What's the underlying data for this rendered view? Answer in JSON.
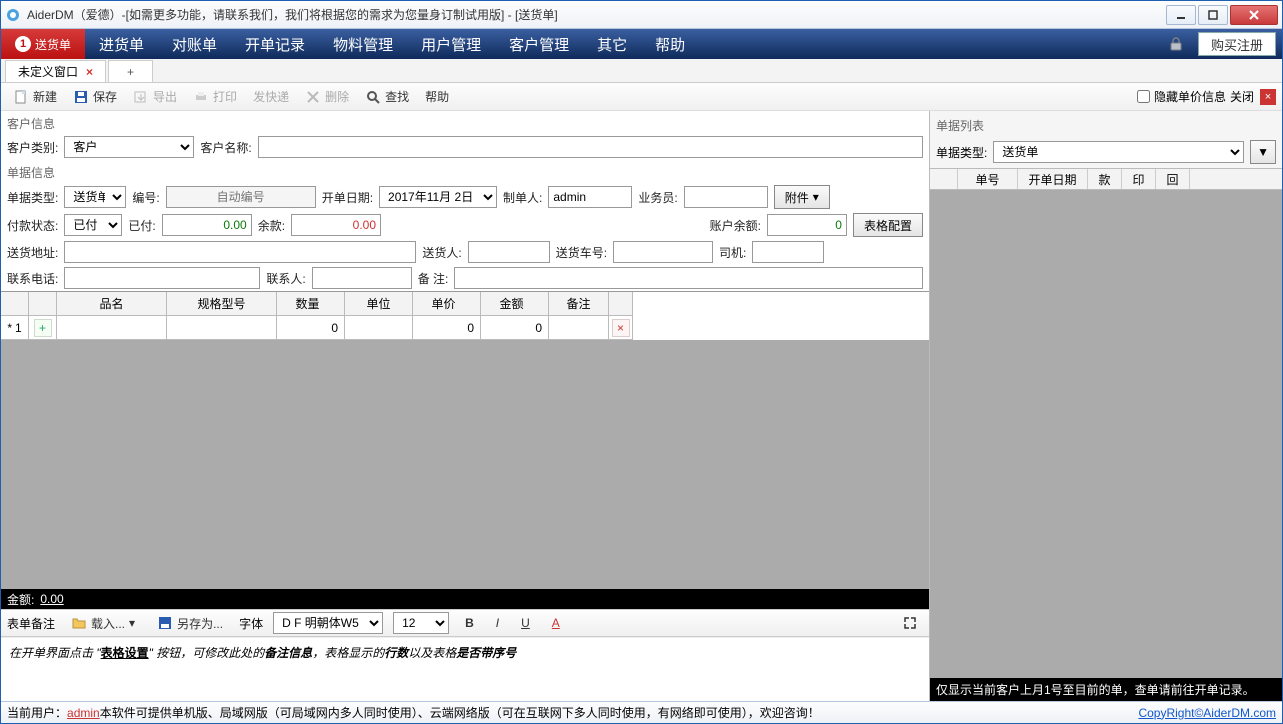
{
  "window": {
    "title": "AiderDM（爱德）-[如需更多功能，请联系我们，我们将根据您的需求为您量身订制试用版] - [送货单]"
  },
  "menubar": {
    "items": [
      "送货单",
      "进货单",
      "对账单",
      "开单记录",
      "物料管理",
      "用户管理",
      "客户管理",
      "其它",
      "帮助"
    ],
    "active_badge": "1",
    "buy": "购买注册"
  },
  "tabs": {
    "t0": "未定义窗口"
  },
  "toolbar": {
    "new": "新建",
    "save": "保存",
    "export": "导出",
    "print": "打印",
    "express": "发快递",
    "delete": "删除",
    "find": "查找",
    "help": "帮助",
    "hideprice": "隐藏单价信息",
    "close": "关闭"
  },
  "cust": {
    "section": "客户信息",
    "type_label": "客户类别:",
    "type_value": "客户",
    "name_label": "客户名称:",
    "name_value": ""
  },
  "doc": {
    "section": "单据信息",
    "type_label": "单据类型:",
    "type_value": "送货单",
    "no_label": "编号:",
    "no_placeholder": "自动编号",
    "date_label": "开单日期:",
    "date_value": "2017年11月  2日",
    "maker_label": "制单人:",
    "maker_value": "admin",
    "sales_label": "业务员:",
    "sales_value": "",
    "attach": "附件",
    "paystat_label": "付款状态:",
    "paystat_value": "已付",
    "paid_label": "已付:",
    "paid_value": "0.00",
    "remain_label": "余款:",
    "remain_value": "0.00",
    "balance_label": "账户余额:",
    "balance_value": "0",
    "tblcfg": "表格配置",
    "addr_label": "送货地址:",
    "addr_value": "",
    "sender_label": "送货人:",
    "sender_value": "",
    "car_label": "送货车号:",
    "car_value": "",
    "driver_label": "司机:",
    "driver_value": "",
    "tel_label": "联系电话:",
    "tel_value": "",
    "contact_label": "联系人:",
    "contact_value": "",
    "note_label": "备  注:",
    "note_value": ""
  },
  "grid": {
    "headers": {
      "name": "品名",
      "spec": "规格型号",
      "qty": "数量",
      "unit": "单位",
      "price": "单价",
      "amt": "金额",
      "note": "备注"
    },
    "row1": {
      "idx": "1",
      "star": "*",
      "qty": "0",
      "price": "0",
      "amt": "0"
    }
  },
  "total": {
    "label": "金额:",
    "value": "0.00"
  },
  "editor": {
    "tabnote": "表单备注",
    "load": "载入...",
    "saveas": "另存为...",
    "fontlbl": "字体",
    "font": "D F 明朝体W5",
    "size": "12",
    "text_prefix": "在开单界面点击 \"",
    "text_bold": "表格设置",
    "text_mid1": "\" 按钮，可修改此处的",
    "text_i1": "备注信息",
    "text_mid2": "，表格显示的",
    "text_i2": "行数",
    "text_mid3": "以及表格",
    "text_i3": "是否带序号"
  },
  "right": {
    "section": "单据列表",
    "type_label": "单据类型:",
    "type_value": "送货单",
    "headers": {
      "no": "单号",
      "date": "开单日期",
      "k": "款",
      "p": "印",
      "b": "回"
    },
    "footer": "仅显示当前客户上月1号至目前的单，查单请前往开单记录。"
  },
  "status": {
    "prefix": "当前用户：",
    "user": "admin",
    "rest": "   本软件可提供单机版、局域网版（可局域网内多人同时使用）、云端网络版（可在互联网下多人同时使用，有网络即可使用），欢迎咨询！",
    "copy": "CopyRight©AiderDM.com"
  }
}
